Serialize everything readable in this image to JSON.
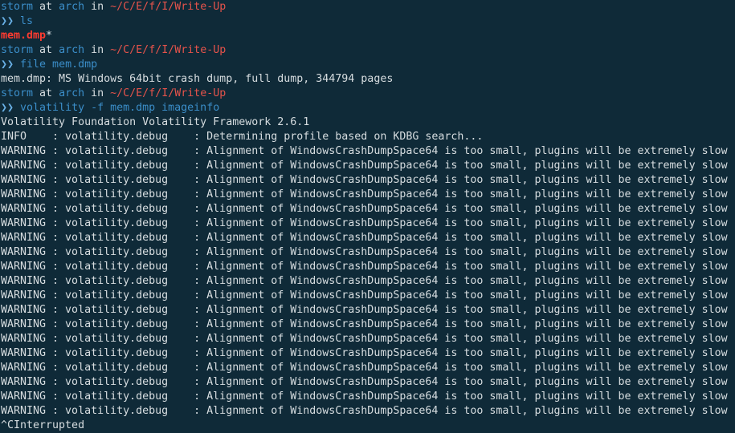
{
  "prompt": {
    "user": "storm",
    "at": "at",
    "host": "arch",
    "in": "in",
    "path": "~/C/E/f/I/Write-Up",
    "arrow": "❯❯"
  },
  "commands": {
    "ls": "ls",
    "file": "file mem.dmp",
    "volatility": "volatility -f mem.dmp imageinfo"
  },
  "ls_output": {
    "file": "mem.dmp",
    "suffix": "*"
  },
  "file_output": "mem.dmp: MS Windows 64bit crash dump, full dump, 344794 pages",
  "vol_header": "Volatility Foundation Volatility Framework 2.6.1",
  "info_line": "INFO    : volatility.debug    : Determining profile based on KDBG search...",
  "warning_lines": [
    "WARNING : volatility.debug    : Alignment of WindowsCrashDumpSpace64 is too small, plugins will be extremely slow",
    "WARNING : volatility.debug    : Alignment of WindowsCrashDumpSpace64 is too small, plugins will be extremely slow",
    "WARNING : volatility.debug    : Alignment of WindowsCrashDumpSpace64 is too small, plugins will be extremely slow",
    "WARNING : volatility.debug    : Alignment of WindowsCrashDumpSpace64 is too small, plugins will be extremely slow",
    "WARNING : volatility.debug    : Alignment of WindowsCrashDumpSpace64 is too small, plugins will be extremely slow",
    "WARNING : volatility.debug    : Alignment of WindowsCrashDumpSpace64 is too small, plugins will be extremely slow",
    "WARNING : volatility.debug    : Alignment of WindowsCrashDumpSpace64 is too small, plugins will be extremely slow",
    "WARNING : volatility.debug    : Alignment of WindowsCrashDumpSpace64 is too small, plugins will be extremely slow",
    "WARNING : volatility.debug    : Alignment of WindowsCrashDumpSpace64 is too small, plugins will be extremely slow",
    "WARNING : volatility.debug    : Alignment of WindowsCrashDumpSpace64 is too small, plugins will be extremely slow",
    "WARNING : volatility.debug    : Alignment of WindowsCrashDumpSpace64 is too small, plugins will be extremely slow",
    "WARNING : volatility.debug    : Alignment of WindowsCrashDumpSpace64 is too small, plugins will be extremely slow",
    "WARNING : volatility.debug    : Alignment of WindowsCrashDumpSpace64 is too small, plugins will be extremely slow",
    "WARNING : volatility.debug    : Alignment of WindowsCrashDumpSpace64 is too small, plugins will be extremely slow",
    "WARNING : volatility.debug    : Alignment of WindowsCrashDumpSpace64 is too small, plugins will be extremely slow",
    "WARNING : volatility.debug    : Alignment of WindowsCrashDumpSpace64 is too small, plugins will be extremely slow",
    "WARNING : volatility.debug    : Alignment of WindowsCrashDumpSpace64 is too small, plugins will be extremely slow",
    "WARNING : volatility.debug    : Alignment of WindowsCrashDumpSpace64 is too small, plugins will be extremely slow",
    "WARNING : volatility.debug    : Alignment of WindowsCrashDumpSpace64 is too small, plugins will be extremely slow"
  ],
  "interrupt_line": "^CInterrupted",
  "colors": {
    "background": "#0f2a38",
    "text": "#d7dde0",
    "prompt_blue": "#3b8ec9",
    "path_red": "#e5534b",
    "exe_red": "#ff3b30"
  }
}
